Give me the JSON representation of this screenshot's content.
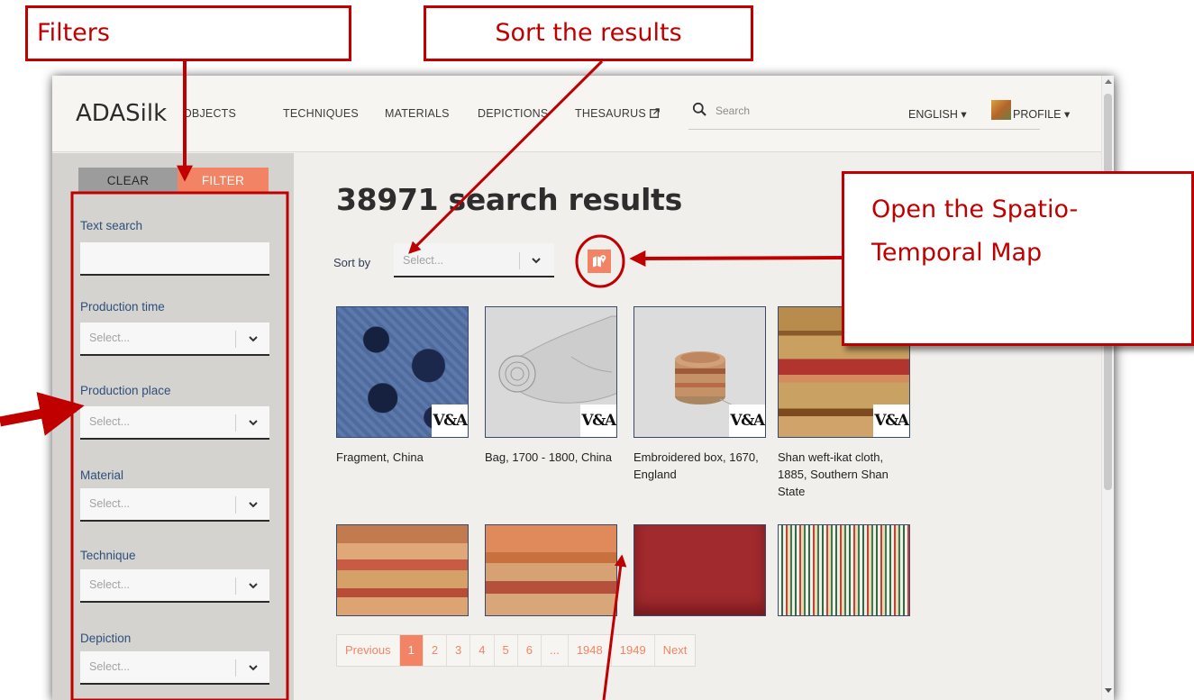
{
  "annotations": {
    "filters": "Filters",
    "sort": "Sort the results",
    "map": "Open the Spatio-Temporal Map",
    "map_line1": "Open the Spatio-",
    "map_line2": "Temporal Map",
    "color": "#c00000"
  },
  "app": {
    "logo": "ADASilk",
    "nav": [
      "OBJECTS",
      "TECHNIQUES",
      "MATERIALS",
      "DEPICTIONS",
      "THESAURUS"
    ],
    "search_placeholder": "Search",
    "language": "ENGLISH ▾",
    "profile": "PROFILE ▾"
  },
  "sidebar": {
    "clear_label": "CLEAR",
    "filter_label": "FILTER",
    "text_search_label": "Text search",
    "text_search_value": "",
    "filters": [
      {
        "label": "Production time",
        "placeholder": "Select..."
      },
      {
        "label": "Production place",
        "placeholder": "Select..."
      },
      {
        "label": "Material",
        "placeholder": "Select..."
      },
      {
        "label": "Technique",
        "placeholder": "Select..."
      },
      {
        "label": "Depiction",
        "placeholder": "Select..."
      }
    ]
  },
  "main": {
    "results_heading": "38971 search results",
    "sort_label": "Sort by",
    "sort_placeholder": "Select...",
    "cards": [
      {
        "title": "Fragment, China",
        "badge": "V&A"
      },
      {
        "title": "Bag, 1700 - 1800, China",
        "badge": "V&A"
      },
      {
        "title": "Embroidered box, 1670, England",
        "badge": "V&A"
      },
      {
        "title": "Shan weft-ikat cloth, 1885, Southern Shan State",
        "badge": "V&A"
      }
    ],
    "pagination": [
      "Previous",
      "1",
      "2",
      "3",
      "4",
      "5",
      "6",
      "...",
      "1948",
      "1949",
      "Next"
    ],
    "accent": "#f28465"
  }
}
